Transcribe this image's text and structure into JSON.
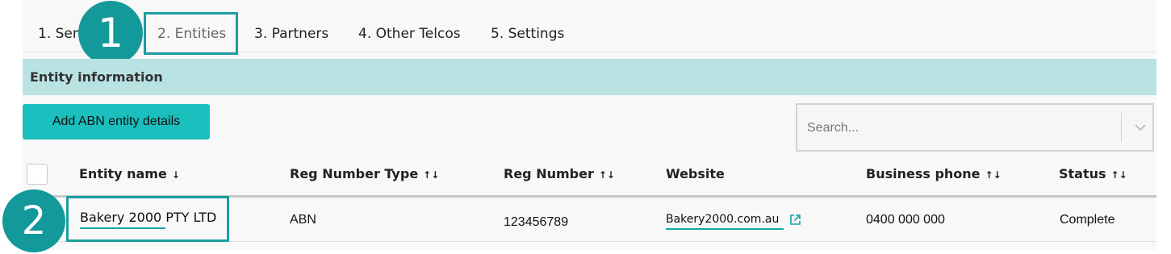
{
  "tabs": [
    {
      "label": "1. Sen"
    },
    {
      "label": "2. Entities"
    },
    {
      "label": "3. Partners"
    },
    {
      "label": "4. Other Telcos"
    },
    {
      "label": "5. Settings"
    }
  ],
  "callouts": {
    "one": "1",
    "two": "2"
  },
  "section": {
    "title": "Entity information"
  },
  "toolbar": {
    "add_label": "Add ABN entity details"
  },
  "search": {
    "placeholder": "Search..."
  },
  "table": {
    "columns": [
      {
        "label": "Entity name",
        "sort": "↓"
      },
      {
        "label": "Reg Number Type",
        "sort": "↑↓"
      },
      {
        "label": "Reg Number",
        "sort": "↑↓"
      },
      {
        "label": "Website",
        "sort": ""
      },
      {
        "label": "Business phone",
        "sort": "↑↓"
      },
      {
        "label": "Status",
        "sort": "↑↓"
      }
    ],
    "rows": [
      {
        "entity_name": "Bakery 2000 PTY LTD",
        "reg_type": "ABN",
        "reg_number": "123456789",
        "website": "Bakery2000.com.au",
        "phone": "0400 000 000",
        "status": "Complete"
      }
    ]
  },
  "colors": {
    "accent": "#1bbfbd",
    "callout": "#14999a",
    "section_bg": "#b9e3e2"
  }
}
